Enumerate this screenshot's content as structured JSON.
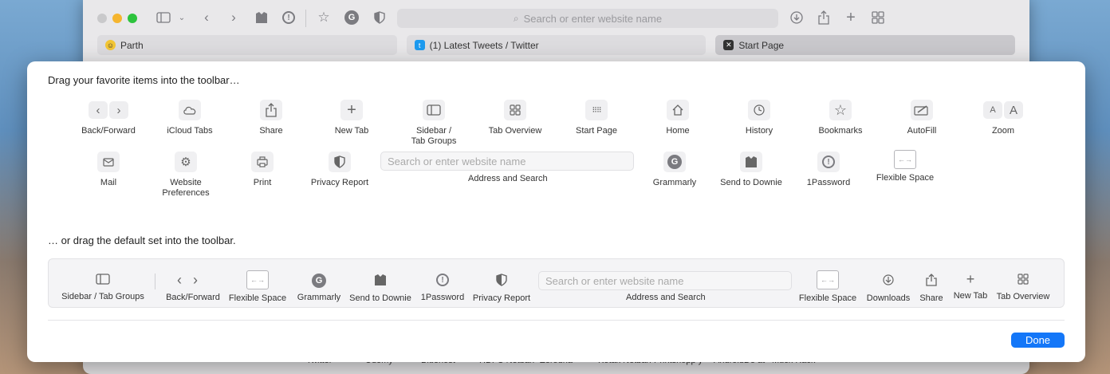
{
  "browser": {
    "address_placeholder": "Search or enter website name",
    "tabs": [
      {
        "label": "Parth",
        "icon": "smiley-icon"
      },
      {
        "label": "(1) Latest Tweets / Twitter",
        "icon": "twitter-icon"
      },
      {
        "label": "Start Page",
        "icon": "x-icon"
      }
    ],
    "background_labels": [
      "Twitter",
      "Udemy",
      "Bluehost",
      "HDFC Netban",
      "Zerodha",
      "Kotak Netban",
      "Printshopp y",
      "AndroidDe at",
      "Muck Rack"
    ]
  },
  "customize": {
    "instruction_top": "Drag your favorite items into the toolbar…",
    "instruction_default": "… or drag the default set into the toolbar.",
    "items_row1": [
      {
        "label": "Back/Forward",
        "icon": "back-forward-icon"
      },
      {
        "label": "iCloud Tabs",
        "icon": "cloud-icon"
      },
      {
        "label": "Share",
        "icon": "share-icon"
      },
      {
        "label": "New Tab",
        "icon": "plus-icon"
      },
      {
        "label": "Sidebar / Tab Groups",
        "icon": "sidebar-icon"
      },
      {
        "label": "Tab Overview",
        "icon": "grid-icon"
      },
      {
        "label": "Start Page",
        "icon": "dots-grid-icon"
      },
      {
        "label": "Home",
        "icon": "home-icon"
      },
      {
        "label": "History",
        "icon": "clock-icon"
      },
      {
        "label": "Bookmarks",
        "icon": "star-icon"
      },
      {
        "label": "AutoFill",
        "icon": "autofill-icon"
      },
      {
        "label": "Zoom",
        "icon": "zoom-icon"
      }
    ],
    "items_row2": [
      {
        "label": "Mail",
        "icon": "mail-icon"
      },
      {
        "label": "Website Preferences",
        "icon": "gear-icon"
      },
      {
        "label": "Print",
        "icon": "print-icon"
      },
      {
        "label": "Privacy Report",
        "icon": "shield-icon"
      },
      {
        "label": "Address and Search",
        "icon": "address-field"
      },
      {
        "label": "Grammarly",
        "icon": "grammarly-icon"
      },
      {
        "label": "Send to Downie",
        "icon": "downie-icon"
      },
      {
        "label": "1Password",
        "icon": "onepassword-icon"
      },
      {
        "label": "Flexible Space",
        "icon": "flexible-space-icon"
      }
    ],
    "address_placeholder": "Search or enter website name",
    "default_set": [
      {
        "label": "Sidebar / Tab Groups",
        "icon": "sidebar-icon"
      },
      {
        "label": "Back/Forward",
        "icon": "back-forward-icon"
      },
      {
        "label": "Flexible Space",
        "icon": "flexible-space-icon"
      },
      {
        "label": "Grammarly",
        "icon": "grammarly-icon"
      },
      {
        "label": "Send to Downie",
        "icon": "downie-icon"
      },
      {
        "label": "1Password",
        "icon": "onepassword-icon"
      },
      {
        "label": "Privacy Report",
        "icon": "shield-icon"
      },
      {
        "label": "Address and Search",
        "icon": "address-field"
      },
      {
        "label": "Flexible Space",
        "icon": "flexible-space-icon"
      },
      {
        "label": "Downloads",
        "icon": "download-icon"
      },
      {
        "label": "Share",
        "icon": "share-icon"
      },
      {
        "label": "New Tab",
        "icon": "plus-icon"
      },
      {
        "label": "Tab Overview",
        "icon": "grid-icon"
      }
    ],
    "done_label": "Done",
    "accent_color": "#1477f8"
  }
}
